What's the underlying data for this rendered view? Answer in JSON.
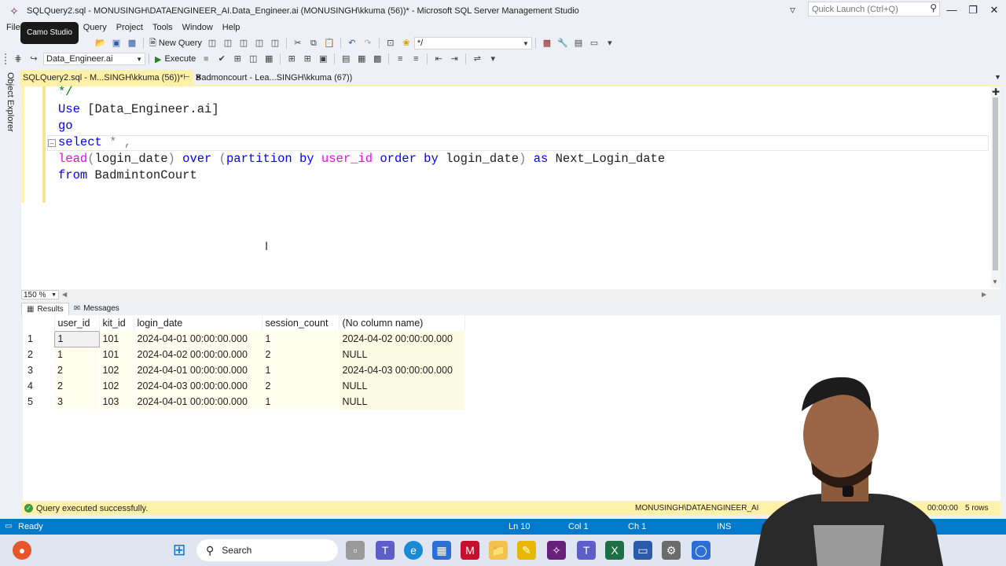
{
  "window": {
    "title": "SQLQuery2.sql - MONUSINGH\\DATAENGINEER_AI.Data_Engineer.ai (MONUSINGH\\kkuma (56))* - Microsoft SQL Server Management Studio",
    "quick_launch_placeholder": "Quick Launch (Ctrl+Q)"
  },
  "tooltip": {
    "text": "Camo Studio"
  },
  "menu": [
    "File",
    "Query",
    "Project",
    "Tools",
    "Window",
    "Help"
  ],
  "toolbar": {
    "new_query": "New Query",
    "comment_combo": "*/",
    "database_combo": "Data_Engineer.ai",
    "execute": "Execute"
  },
  "side_panel": {
    "label": "Object Explorer"
  },
  "tabs": [
    {
      "label": "SQLQuery2.sql - M...SINGH\\kkuma (56))*",
      "active": true
    },
    {
      "label": "Badmoncourt - Lea...SINGH\\kkuma (67))",
      "active": false
    }
  ],
  "editor": {
    "zoom": "150 %",
    "lines": {
      "l1": "*/",
      "l2_kw": "Use",
      "l2_rest": " [Data_Engineer.ai]",
      "l3": "go",
      "l4_kw": "select",
      "l4_rest": " * ,",
      "l5_fn": "lead",
      "l5_a": "(",
      "l5_b": "login_date",
      "l5_c": ") ",
      "l5_over": "over",
      "l5_d": " (",
      "l5_part": "partition by",
      "l5_e": " ",
      "l5_uid": "user_id",
      "l5_f": " ",
      "l5_order": "order by",
      "l5_g": " login_date",
      "l5_h": ") ",
      "l5_as": "as",
      "l5_i": " Next_Login_date",
      "l6_kw": "from",
      "l6_rest": " BadmintonCourt"
    }
  },
  "results_tabs": {
    "results": "Results",
    "messages": "Messages"
  },
  "results": {
    "columns": [
      "user_id",
      "kit_id",
      "login_date",
      "session_count",
      "(No column name)"
    ],
    "rows": [
      {
        "n": "1",
        "user_id": "1",
        "kit_id": "101",
        "login_date": "2024-04-01 00:00:00.000",
        "session_count": "1",
        "next": "2024-04-02 00:00:00.000"
      },
      {
        "n": "2",
        "user_id": "1",
        "kit_id": "101",
        "login_date": "2024-04-02 00:00:00.000",
        "session_count": "2",
        "next": "NULL"
      },
      {
        "n": "3",
        "user_id": "2",
        "kit_id": "102",
        "login_date": "2024-04-01 00:00:00.000",
        "session_count": "1",
        "next": "2024-04-03 00:00:00.000"
      },
      {
        "n": "4",
        "user_id": "2",
        "kit_id": "102",
        "login_date": "2024-04-03 00:00:00.000",
        "session_count": "2",
        "next": "NULL"
      },
      {
        "n": "5",
        "user_id": "3",
        "kit_id": "103",
        "login_date": "2024-04-01 00:00:00.000",
        "session_count": "1",
        "next": "NULL"
      }
    ]
  },
  "query_status": {
    "message": "Query executed successfully.",
    "server": "MONUSINGH\\DATAENGINEER_AI",
    "elapsed": "00:00:00",
    "rows": "5 rows"
  },
  "statusbar": {
    "ready": "Ready",
    "ln": "Ln 10",
    "col": "Col 1",
    "ch": "Ch 1",
    "ins": "INS"
  },
  "taskbar": {
    "search": "Search"
  },
  "colors": {
    "accent": "#007acc",
    "tab_active": "#fff1a8",
    "keyword": "#0000ff",
    "function": "#ff00ff",
    "operator": "#808080"
  }
}
